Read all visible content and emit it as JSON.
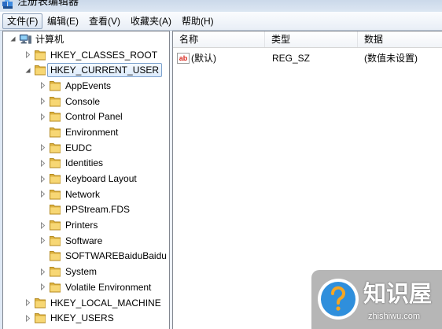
{
  "window": {
    "title": "注册表编辑器",
    "icon": "registry-editor-icon"
  },
  "menu": [
    {
      "label": "文件(F)",
      "active": true
    },
    {
      "label": "编辑(E)"
    },
    {
      "label": "查看(V)"
    },
    {
      "label": "收藏夹(A)"
    },
    {
      "label": "帮助(H)"
    }
  ],
  "tree": {
    "default_icon": "folder-icon",
    "root": {
      "label": "计算机",
      "icon": "computer-icon",
      "expanded": true,
      "children": [
        {
          "label": "HKEY_CLASSES_ROOT",
          "has_children": true
        },
        {
          "label": "HKEY_CURRENT_USER",
          "expanded": true,
          "selected": true,
          "children": [
            {
              "label": "AppEvents",
              "has_children": true
            },
            {
              "label": "Console",
              "has_children": true
            },
            {
              "label": "Control Panel",
              "has_children": true
            },
            {
              "label": "Environment",
              "has_children": false
            },
            {
              "label": "EUDC",
              "has_children": true
            },
            {
              "label": "Identities",
              "has_children": true
            },
            {
              "label": "Keyboard Layout",
              "has_children": true
            },
            {
              "label": "Network",
              "has_children": true
            },
            {
              "label": "PPStream.FDS",
              "has_children": false
            },
            {
              "label": "Printers",
              "has_children": true
            },
            {
              "label": "Software",
              "has_children": true
            },
            {
              "label": "SOFTWAREBaiduBaidu",
              "has_children": false
            },
            {
              "label": "System",
              "has_children": true
            },
            {
              "label": "Volatile Environment",
              "has_children": true
            }
          ]
        },
        {
          "label": "HKEY_LOCAL_MACHINE",
          "has_children": true
        },
        {
          "label": "HKEY_USERS",
          "has_children": true
        }
      ]
    }
  },
  "values": {
    "columns": [
      "名称",
      "类型",
      "数据"
    ],
    "rows": [
      {
        "icon": "string-value-icon",
        "icon_glyph": "ab",
        "name": "(默认)",
        "type": "REG_SZ",
        "data": "(数值未设置)"
      }
    ]
  },
  "watermark": {
    "icon": "question-mark-logo-icon",
    "name": "知识屋",
    "url": "zhishiwu.com"
  },
  "colors": {
    "selection_border": "#7da2ce",
    "value_icon_text": "#d7261c",
    "logo_blue": "#2f8fdc"
  }
}
